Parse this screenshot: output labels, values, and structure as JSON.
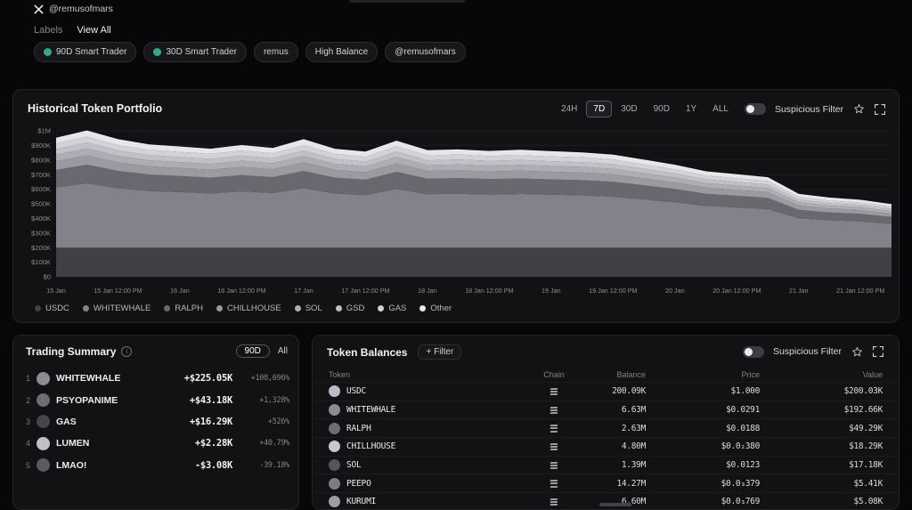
{
  "header": {
    "handle": "@remusofmars",
    "labels_title": "Labels",
    "view_all": "View All",
    "chips": [
      {
        "label": "90D Smart Trader",
        "icon": "smart-trader-icon"
      },
      {
        "label": "30D Smart Trader",
        "icon": "smart-trader-icon"
      },
      {
        "label": "remus"
      },
      {
        "label": "High Balance"
      },
      {
        "label": "@remusofmars"
      }
    ]
  },
  "portfolio_panel": {
    "title": "Historical Token Portfolio",
    "ranges": [
      "24H",
      "7D",
      "30D",
      "90D",
      "1Y",
      "ALL"
    ],
    "selected_range": "7D",
    "suspicious_filter_label": "Suspicious Filter"
  },
  "chart_data": {
    "type": "area",
    "stacked": true,
    "title": "Historical Token Portfolio",
    "unit_scale": "values are thousands of USD",
    "ylim_k": [
      0,
      1000
    ],
    "y_tick_labels": [
      "$0",
      "$100K",
      "$200K",
      "$300K",
      "$400K",
      "$500K",
      "$600K",
      "$700K",
      "$800K",
      "$900K",
      "$1M"
    ],
    "x_tick_labels": [
      "15 Jan",
      "15 Jan 12:00 PM",
      "16 Jan",
      "16 Jan 12:00 PM",
      "17 Jan",
      "17 Jan 12:00 PM",
      "18 Jan",
      "18 Jan 12:00 PM",
      "19 Jan",
      "19 Jan 12:00 PM",
      "20 Jan",
      "20 Jan 12:00 PM",
      "21 Jan",
      "21 Jan 12:00 PM"
    ],
    "points_per_tick": 2,
    "legend_position": "bottom",
    "grid": true,
    "series": [
      {
        "name": "USDC",
        "color": "#404046",
        "values": [
          200,
          200,
          200,
          200,
          200,
          200,
          200,
          200,
          200,
          200,
          200,
          200,
          200,
          200,
          200,
          200,
          200,
          200,
          200,
          200,
          200,
          200,
          200,
          200,
          200,
          200,
          200,
          200
        ]
      },
      {
        "name": "WHITEWHALE",
        "color": "#82828a",
        "values": [
          412,
          440,
          407,
          388,
          380,
          371,
          385,
          374,
          407,
          371,
          360,
          402,
          366,
          369,
          363,
          367,
          362,
          358,
          349,
          330,
          311,
          286,
          275,
          264,
          201,
          187,
          179,
          162
        ]
      },
      {
        "name": "RALPH",
        "color": "#68686f",
        "values": [
          120,
          128,
          118,
          113,
          110,
          108,
          112,
          109,
          118,
          108,
          105,
          117,
          106,
          107,
          106,
          107,
          105,
          104,
          102,
          96,
          90,
          83,
          80,
          77,
          58,
          54,
          52,
          47
        ]
      },
      {
        "name": "CHILLHOUSE",
        "color": "#9a9aa2",
        "values": [
          60,
          64,
          59,
          56,
          55,
          54,
          56,
          54,
          59,
          54,
          52,
          58,
          53,
          54,
          53,
          53,
          53,
          52,
          51,
          48,
          45,
          42,
          40,
          38,
          29,
          27,
          26,
          24
        ]
      },
      {
        "name": "SOL",
        "color": "#adadb4",
        "values": [
          45,
          48,
          44,
          42,
          41,
          41,
          42,
          41,
          44,
          41,
          39,
          44,
          40,
          40,
          40,
          40,
          39,
          39,
          38,
          36,
          34,
          31,
          30,
          29,
          22,
          20,
          20,
          18
        ]
      },
      {
        "name": "GSD",
        "color": "#c0c0c6",
        "values": [
          38,
          40,
          37,
          35,
          35,
          34,
          35,
          34,
          37,
          34,
          33,
          37,
          33,
          34,
          33,
          33,
          33,
          33,
          32,
          30,
          28,
          26,
          25,
          24,
          18,
          17,
          16,
          15
        ]
      },
      {
        "name": "GAS",
        "color": "#d2d2d7",
        "values": [
          38,
          40,
          37,
          35,
          35,
          34,
          35,
          34,
          37,
          34,
          33,
          37,
          33,
          34,
          33,
          33,
          33,
          33,
          32,
          30,
          28,
          26,
          25,
          24,
          18,
          17,
          16,
          15
        ]
      },
      {
        "name": "Other",
        "color": "#e6e6ea",
        "values": [
          37,
          40,
          38,
          36,
          34,
          33,
          35,
          34,
          38,
          33,
          33,
          35,
          34,
          32,
          32,
          35,
          33,
          31,
          31,
          30,
          29,
          26,
          25,
          24,
          19,
          18,
          16,
          14
        ]
      }
    ]
  },
  "trading_summary": {
    "title": "Trading Summary",
    "range_selected": "90D",
    "range_all": "All",
    "rows": [
      {
        "rank": "1",
        "token": "WHITEWHALE",
        "value": "+$225.05K",
        "pct": "+108,696%",
        "icon_color": "#8b8b92"
      },
      {
        "rank": "2",
        "token": "PSYOPANIME",
        "value": "+$43.18K",
        "pct": "+1,328%",
        "icon_color": "#6d6d74"
      },
      {
        "rank": "3",
        "token": "GAS",
        "value": "+$16.29K",
        "pct": "+526%",
        "icon_color": "#44444b"
      },
      {
        "rank": "4",
        "token": "LUMEN",
        "value": "+$2.28K",
        "pct": "+40.79%",
        "icon_color": "#c0c0c6"
      },
      {
        "rank": "5",
        "token": "LMAO!",
        "value": "-$3.08K",
        "pct": "-39.18%",
        "icon_color": "#5a5a61"
      }
    ]
  },
  "token_balances": {
    "title": "Token Balances",
    "filter_label": "+ Filter",
    "suspicious_filter_label": "Suspicious Filter",
    "columns": [
      "Token",
      "Chain",
      "Balance",
      "Price",
      "Value"
    ],
    "rows": [
      {
        "token": "USDC",
        "chain": "solana",
        "balance": "200.09K",
        "price": "$1.000",
        "value": "$200.03K",
        "icon_color": "#b9bcc4"
      },
      {
        "token": "WHITEWHALE",
        "chain": "solana",
        "balance": "6.63M",
        "price": "$0.0291",
        "value": "$192.66K",
        "icon_color": "#8b8b92"
      },
      {
        "token": "RALPH",
        "chain": "solana",
        "balance": "2.63M",
        "price": "$0.0188",
        "value": "$49.29K",
        "icon_color": "#6d6d74"
      },
      {
        "token": "CHILLHOUSE",
        "chain": "solana",
        "balance": "4.80M",
        "price": "$0.0₂380",
        "value": "$18.29K",
        "icon_color": "#c8c8cd"
      },
      {
        "token": "SOL",
        "chain": "solana",
        "balance": "1.39M",
        "price": "$0.0123",
        "value": "$17.18K",
        "icon_color": "#55555d"
      },
      {
        "token": "PEEPO",
        "chain": "solana",
        "balance": "14.27M",
        "price": "$0.0₃379",
        "value": "$5.41K",
        "icon_color": "#7d7d85"
      },
      {
        "token": "KURUMI",
        "chain": "solana",
        "balance": "6.60M",
        "price": "$0.0₃769",
        "value": "$5.08K",
        "icon_color": "#9d9da4"
      }
    ]
  }
}
